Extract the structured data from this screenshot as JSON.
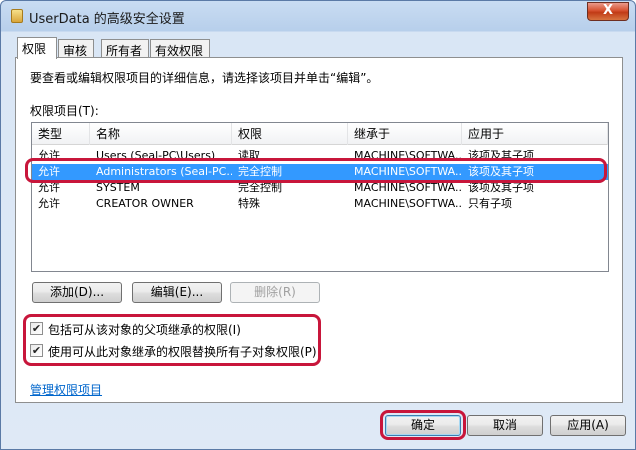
{
  "window": {
    "title": "UserData 的高级安全设置",
    "close_glyph": "X"
  },
  "tabs": [
    {
      "label": "权限"
    },
    {
      "label": "审核"
    },
    {
      "label": "所有者"
    },
    {
      "label": "有效权限"
    }
  ],
  "instruction": "要查看或编辑权限项目的详细信息，请选择该项目并单击“编辑”。",
  "permissions": {
    "label": "权限项目(T):",
    "columns": [
      "类型",
      "名称",
      "权限",
      "继承于",
      "应用于"
    ],
    "rows": [
      [
        "允许",
        "Users (Seal-PC\\Users)",
        "读取",
        "MACHINE\\SOFTWA...",
        "该项及其子项"
      ],
      [
        "允许",
        "Administrators (Seal-PC...",
        "完全控制",
        "MACHINE\\SOFTWA...",
        "该项及其子项"
      ],
      [
        "允许",
        "SYSTEM",
        "完全控制",
        "MACHINE\\SOFTWA...",
        "该项及其子项"
      ],
      [
        "允许",
        "CREATOR OWNER",
        "特殊",
        "MACHINE\\SOFTWA...",
        "只有子项"
      ]
    ],
    "selected_row": 1
  },
  "buttons": {
    "add": "添加(D)...",
    "edit": "编辑(E)...",
    "remove": "删除(R)"
  },
  "checkboxes": [
    {
      "label": "包括可从该对象的父项继承的权限(I)",
      "checked": true,
      "glyph": "✔"
    },
    {
      "label": "使用可从此对象继承的权限替换所有子对象权限(P)",
      "checked": true,
      "glyph": "✔"
    }
  ],
  "manage_link": "管理权限项目",
  "footer": {
    "ok": "确定",
    "cancel": "取消",
    "apply": "应用(A)"
  },
  "colors": {
    "highlight": "#c8163b",
    "selection": "#3399ff",
    "link": "#0066cc"
  }
}
